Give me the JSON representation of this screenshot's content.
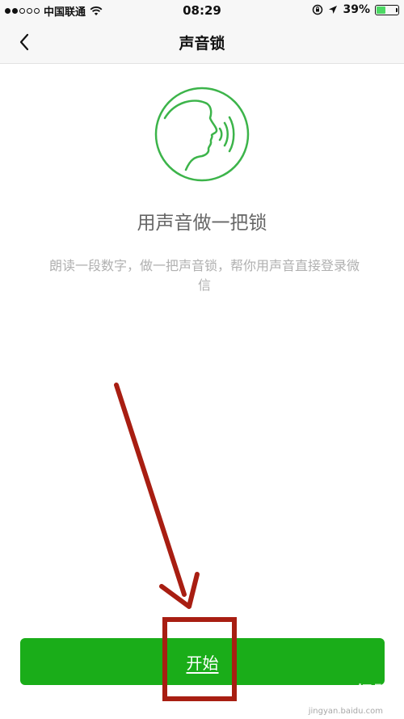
{
  "status_bar": {
    "carrier": "中国联通",
    "time": "08:29",
    "battery_percent": "39%",
    "battery_level": 0.39,
    "signal_bars_filled": 2,
    "signal_bars_total": 5,
    "icons": [
      "signal-icon",
      "wifi-icon",
      "orientation-lock-icon",
      "location-arrow-icon",
      "battery-icon"
    ]
  },
  "nav": {
    "title": "声音锁",
    "back_icon": "chevron-left-icon"
  },
  "content": {
    "icon": "voice-face-icon",
    "headline": "用声音做一把锁",
    "description": "朗读一段数字，做一把声音锁，帮你用声音直接登录微信"
  },
  "actions": {
    "start_label": "开始"
  },
  "watermark": {
    "text": "Bai 经验",
    "sub": "jingyan.baidu.com"
  },
  "colors": {
    "accent": "#1aad19",
    "icon_green": "#3cb44a",
    "annotation_red": "#a81e12",
    "nav_bg": "#f7f7f7"
  }
}
